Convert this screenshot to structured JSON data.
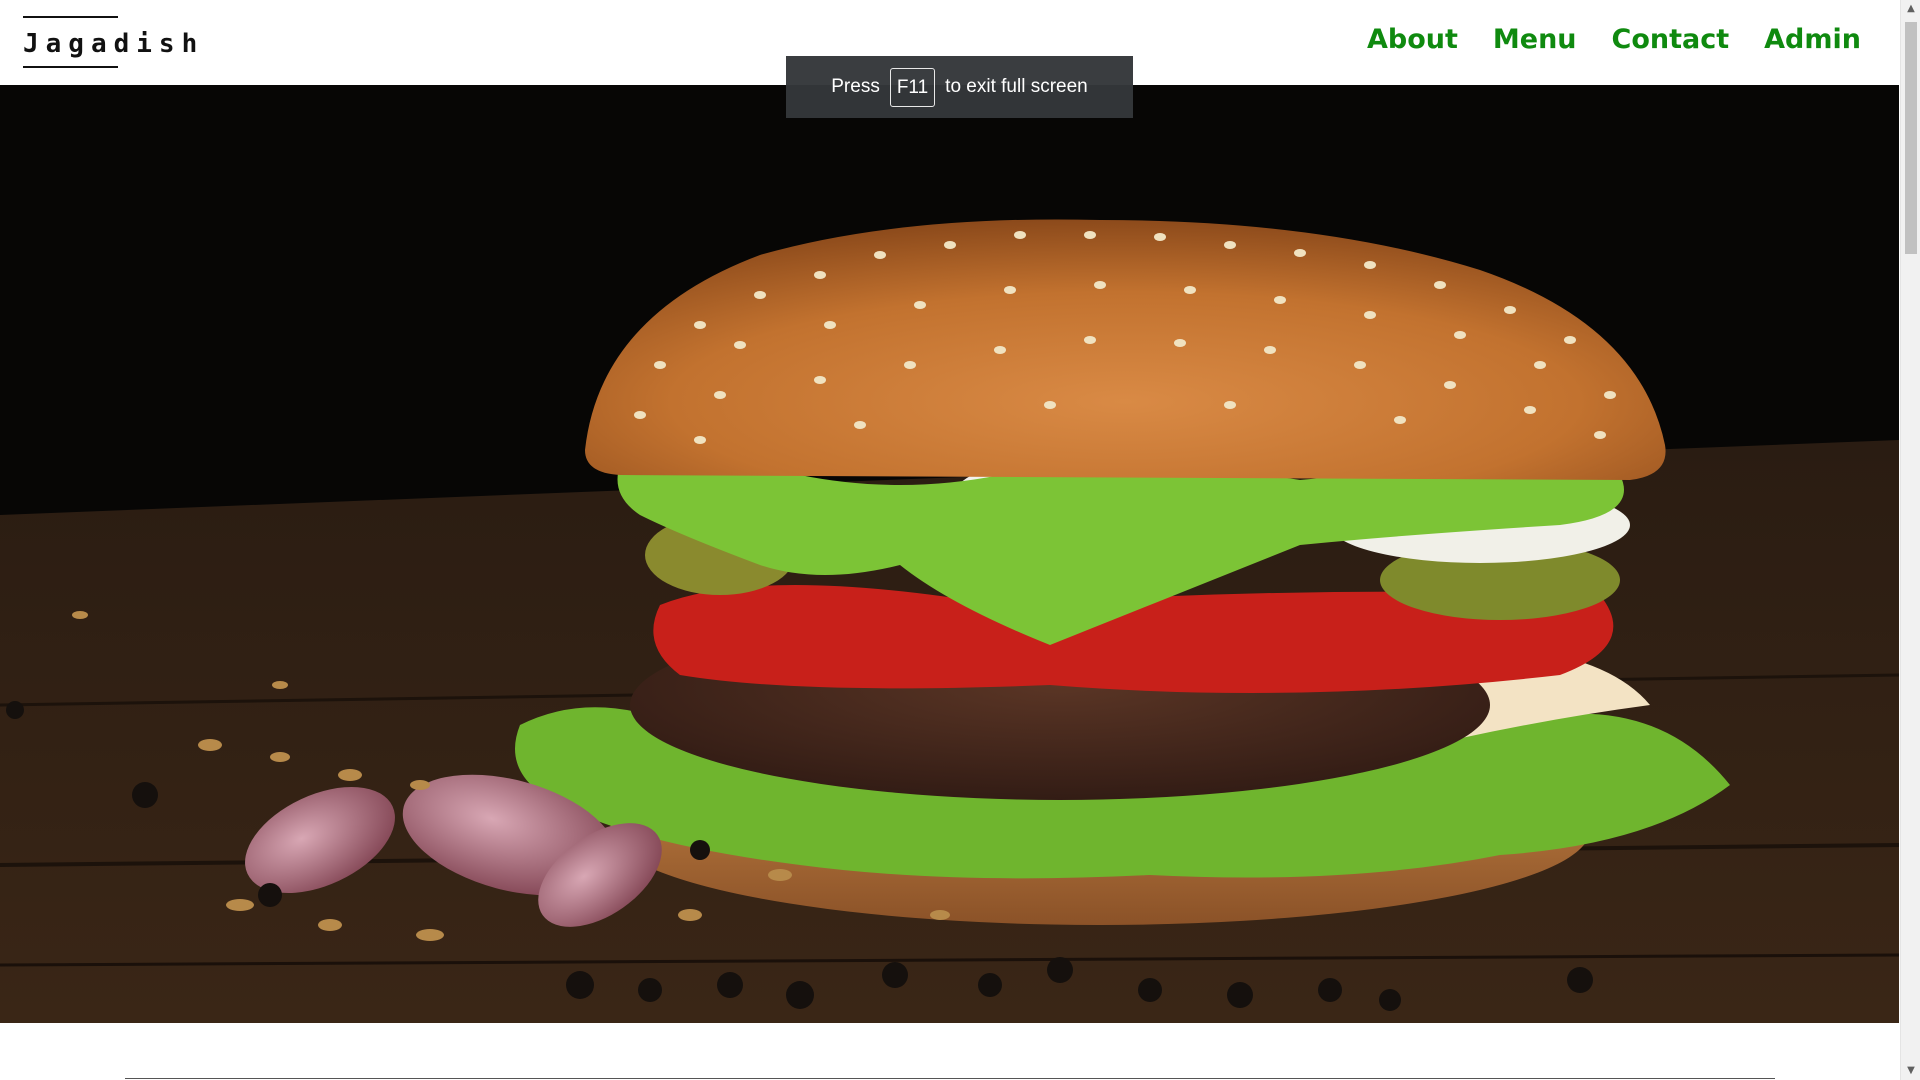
{
  "header": {
    "logo_text": "Jagadish",
    "nav": [
      {
        "label": "About"
      },
      {
        "label": "Menu"
      },
      {
        "label": "Contact"
      },
      {
        "label": "Admin"
      }
    ]
  },
  "fullscreen_toast": {
    "prefix": "Press",
    "key": "F11",
    "suffix": "to exit full screen"
  },
  "hero": {
    "image": "burger-photo",
    "background_color": "#0a0806",
    "table_color": "#2f2014"
  },
  "colors": {
    "nav_link": "#0f8a0f",
    "logo": "#111111"
  },
  "scrollbar": {
    "up_icon": "triangle-up-icon",
    "down_icon": "triangle-down-icon"
  }
}
